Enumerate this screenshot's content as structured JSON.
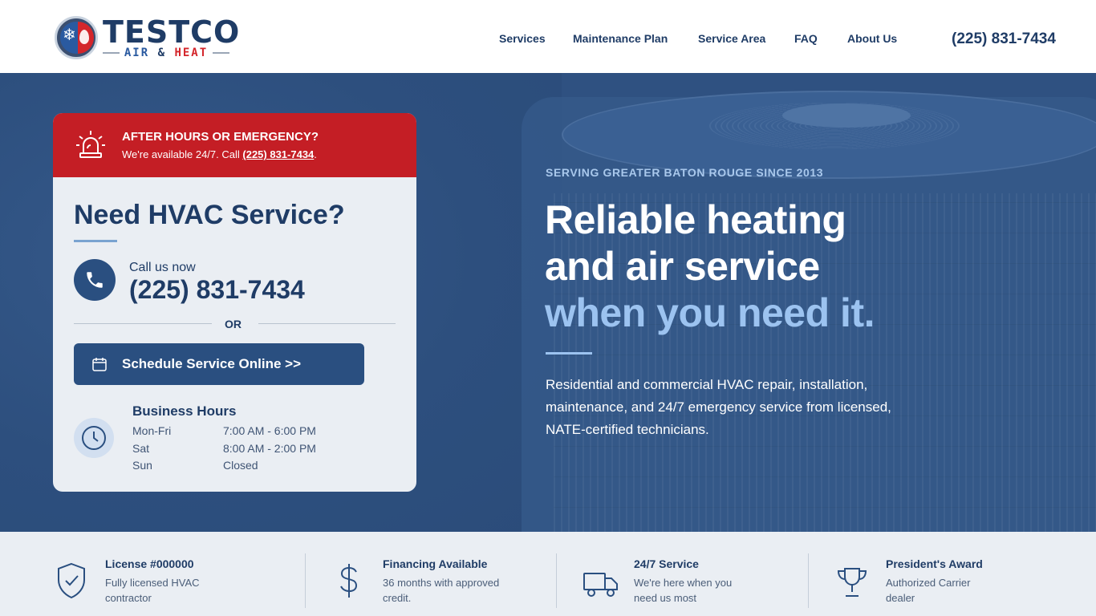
{
  "brand": {
    "name": "TESTCO",
    "sub_air": "AIR",
    "sub_amp": "&",
    "sub_heat": "HEAT"
  },
  "nav": {
    "items": [
      {
        "label": "Services"
      },
      {
        "label": "Maintenance Plan"
      },
      {
        "label": "Service Area"
      },
      {
        "label": "FAQ"
      },
      {
        "label": "About Us"
      }
    ],
    "phone": "(225) 831-7434"
  },
  "alert": {
    "title": "AFTER HOURS OR EMERGENCY?",
    "text": "We're available 24/7. Call ",
    "phone": "(225) 831-7434",
    "suffix": "."
  },
  "card": {
    "title": "Need HVAC Service?",
    "call_label": "Call us now",
    "phone": "(225) 831-7434",
    "or": "OR",
    "schedule_label": "Schedule Service Online >>",
    "hours_title": "Business Hours",
    "hours": [
      {
        "day": "Mon-Fri",
        "time": "7:00 AM - 6:00 PM"
      },
      {
        "day": "Sat",
        "time": "8:00 AM - 2:00 PM"
      },
      {
        "day": "Sun",
        "time": "Closed"
      }
    ]
  },
  "hero": {
    "eyebrow": "SERVING GREATER BATON ROUGE SINCE 2013",
    "line1": "Reliable heating",
    "line2": "and air service",
    "line3": "when you need it.",
    "description": "Residential and commercial HVAC repair, installation, maintenance, and 24/7 emergency service from licensed, NATE-certified technicians."
  },
  "features": [
    {
      "icon": "shield-check-icon",
      "title": "License #000000",
      "desc": "Fully licensed HVAC contractor"
    },
    {
      "icon": "dollar-icon",
      "title": "Financing Available",
      "desc": "36 months with approved credit."
    },
    {
      "icon": "truck-icon",
      "title": "24/7 Service",
      "desc": "We're here when you need us most"
    },
    {
      "icon": "trophy-icon",
      "title": "President's Award",
      "desc": "Authorized Carrier dealer"
    }
  ],
  "colors": {
    "navy": "#1f3c66",
    "hero_bg": "#2f5181",
    "accent_red": "#c41e25",
    "highlight_blue": "#9cc3f0"
  }
}
